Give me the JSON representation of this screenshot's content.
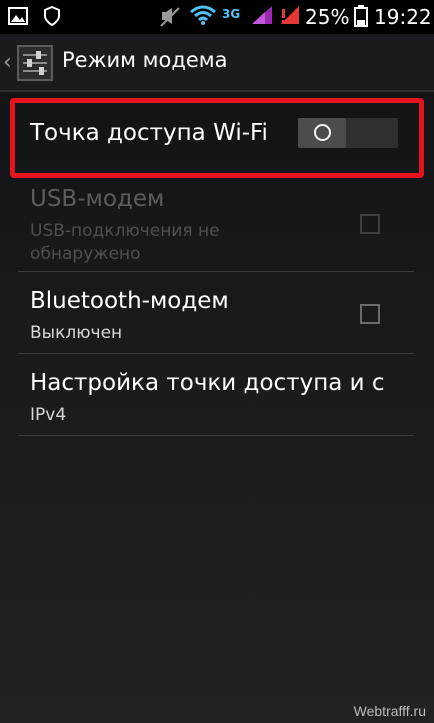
{
  "status_bar": {
    "network_type": "3G",
    "battery_percent": "25%",
    "time": "19:22",
    "icons": [
      "gallery-icon",
      "shield-icon",
      "muted-icon",
      "wifi-icon",
      "signal-icon",
      "signal-alert-icon",
      "battery-icon"
    ]
  },
  "action_bar": {
    "back_glyph": "‹",
    "title": "Режим модема",
    "icon": "settings-sliders-icon"
  },
  "settings": {
    "wifi_hotspot": {
      "title": "Точка доступа Wi-Fi",
      "toggle_on": false
    },
    "usb_modem": {
      "title": "USB-модем",
      "subtitle_line1": "USB-подключения не",
      "subtitle_line2": "обнаружено",
      "enabled": false,
      "checked": false
    },
    "bluetooth_modem": {
      "title": "Bluetooth-модем",
      "subtitle": "Выключен",
      "checked": false
    },
    "hotspot_settings": {
      "title": "Настройка точки доступа и с",
      "subtitle": "IPv4"
    }
  },
  "highlight_color": "#e3141b",
  "watermark": "Webtrafff.ru"
}
